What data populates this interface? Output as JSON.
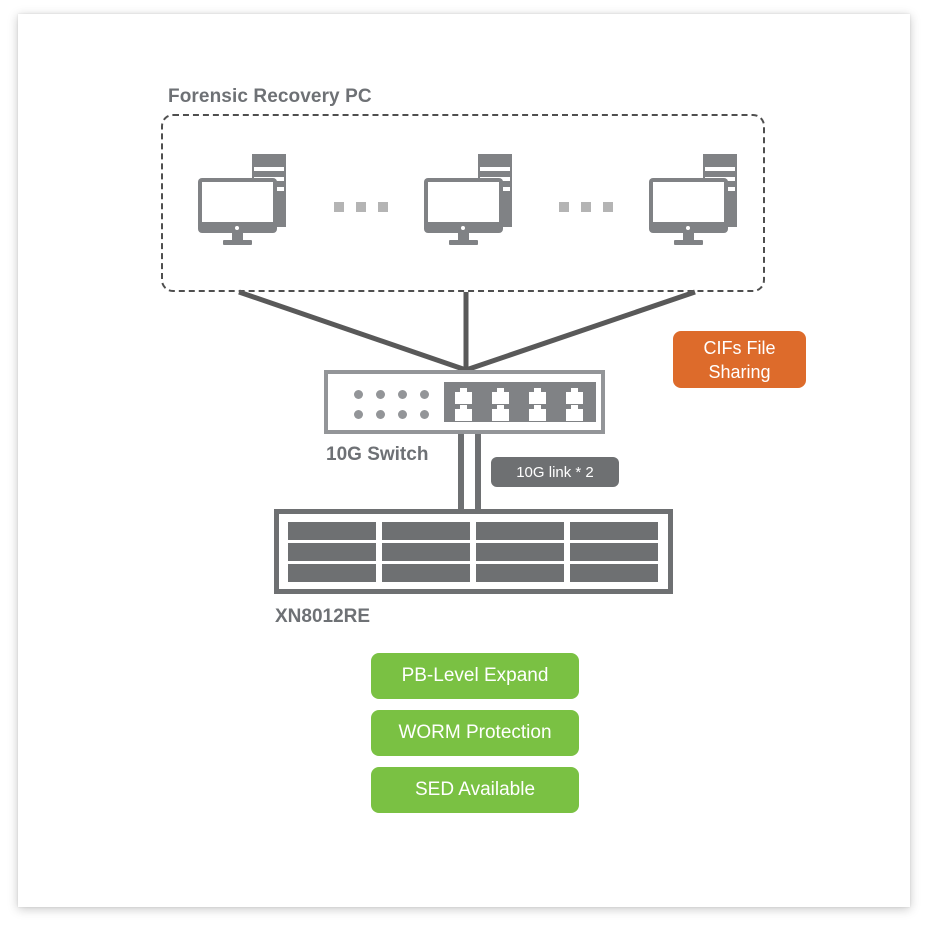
{
  "diagram": {
    "title": "Forensic Recovery PC",
    "client_group": {
      "label": "Forensic Recovery PC",
      "nodes": [
        {
          "name": "Forensic Recovery PC 1",
          "icon": "desktop-computer-icon"
        },
        {
          "name": "Forensic Recovery PC 2",
          "icon": "desktop-computer-icon"
        },
        {
          "name": "Forensic Recovery PC 3",
          "icon": "desktop-computer-icon"
        }
      ],
      "ellipsis_text": "..."
    },
    "switch": {
      "label": "10G Switch",
      "led_count": 8,
      "port_count": 8
    },
    "link": {
      "badge": "10G link * 2",
      "count": 2
    },
    "storage": {
      "label": "XN8012RE",
      "bay_count": 12,
      "bay_columns": 4,
      "bay_rows": 3
    },
    "protocol_badge": {
      "line1": "CIFs File",
      "line2": "Sharing"
    },
    "features": [
      {
        "label": "PB-Level Expand"
      },
      {
        "label": "WORM Protection"
      },
      {
        "label": "SED Available"
      }
    ],
    "colors": {
      "feature_green": "#7ac143",
      "protocol_orange": "#dd6b2b",
      "device_gray": "#808285",
      "label_gray": "#6e7175",
      "line_gray": "#595959"
    }
  }
}
